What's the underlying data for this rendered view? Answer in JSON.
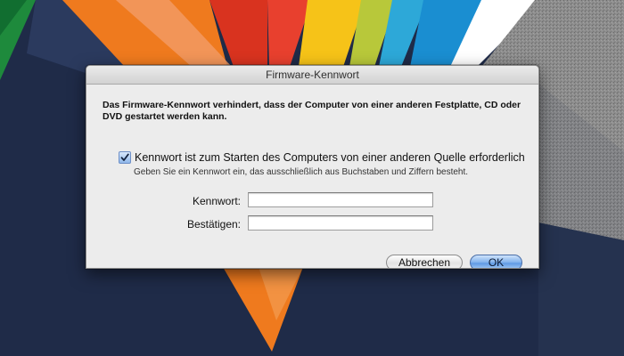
{
  "dialog": {
    "title": "Firmware-Kennwort",
    "intro_text": "Das Firmware-Kennwort verhindert, dass der Computer von einer anderen Festplatte, CD oder DVD gestartet werden kann.",
    "checkbox": {
      "label": "Kennwort ist zum Starten des Computers von einer anderen Quelle erforderlich",
      "checked": true
    },
    "hint_text": "Geben Sie ein Kennwort ein, das ausschließlich aus Buchstaben und Ziffern besteht.",
    "password_label": "Kennwort:",
    "password_value": "",
    "confirm_label": "Bestätigen:",
    "confirm_value": "",
    "cancel_label": "Abbrechen",
    "ok_label": "OK"
  },
  "colors": {
    "accent": "#5e99e4",
    "dialog_bg": "#ececec",
    "background": "#1f2b48"
  }
}
